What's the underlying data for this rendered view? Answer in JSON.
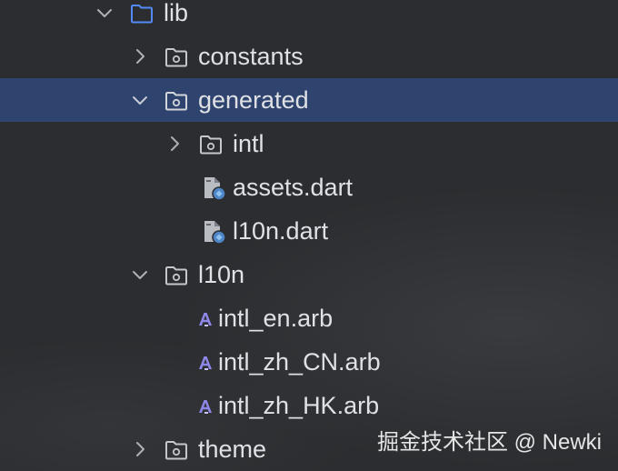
{
  "tree": {
    "lib": {
      "label": "lib",
      "icon": "folder-icon",
      "expanded": true
    },
    "constants": {
      "label": "constants",
      "icon": "package-folder-icon",
      "expanded": false
    },
    "generated": {
      "label": "generated",
      "icon": "package-folder-icon",
      "expanded": true,
      "selected": true
    },
    "intl": {
      "label": "intl",
      "icon": "package-folder-icon",
      "expanded": false
    },
    "assets": {
      "label": "assets.dart",
      "icon": "dart-file-icon"
    },
    "l10n_dart": {
      "label": "l10n.dart",
      "icon": "dart-file-icon"
    },
    "l10n": {
      "label": "l10n",
      "icon": "package-folder-icon",
      "expanded": true
    },
    "intl_en": {
      "label": "intl_en.arb",
      "icon": "arb-file-icon"
    },
    "intl_zh_CN": {
      "label": "intl_zh_CN.arb",
      "icon": "arb-file-icon"
    },
    "intl_zh_HK": {
      "label": "intl_zh_HK.arb",
      "icon": "arb-file-icon"
    },
    "theme": {
      "label": "theme",
      "icon": "package-folder-icon",
      "expanded": false
    }
  },
  "watermark": {
    "text": "掘金技术社区 @ Newki"
  },
  "colors": {
    "background": "#2b2d30",
    "selection": "#2e436e",
    "text": "#dfe1e5",
    "lib_folder": "#548af7",
    "arb_icon": "#8f87e8",
    "dart_badge": "#4e86c8"
  }
}
